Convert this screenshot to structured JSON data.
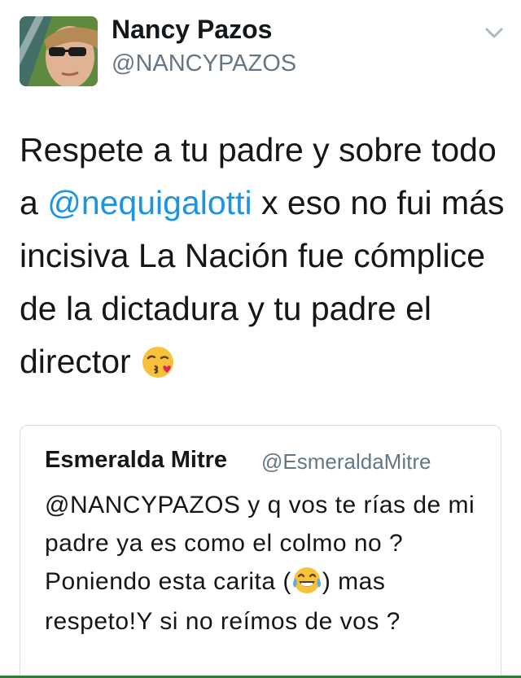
{
  "tweet": {
    "author_name": "Nancy Pazos",
    "author_handle": "@NANCYPAZOS",
    "text_part1": "Respete a tu padre y sobre todo a ",
    "mention": "@nequigalotti",
    "text_part2": " x eso no fui más incisiva La Nación fue cómplice de la dictadura y tu padre el director",
    "emoji": "face-blowing-kiss-icon"
  },
  "quoted_tweet": {
    "author_name": "Esmeralda Mitre",
    "author_handle": "@EsmeraldaMitre",
    "text_part1": "@NANCYPAZOS y q vos te rías de mi padre ya es como el colmo no ? Poniendo esta carita (",
    "emoji": "face-with-tears-of-joy-icon",
    "text_part2": ") mas respeto!Y si no reímos de vos ?"
  },
  "colors": {
    "mention": "#1b95e0",
    "secondary_text": "#657786",
    "border": "#d8dee3"
  }
}
